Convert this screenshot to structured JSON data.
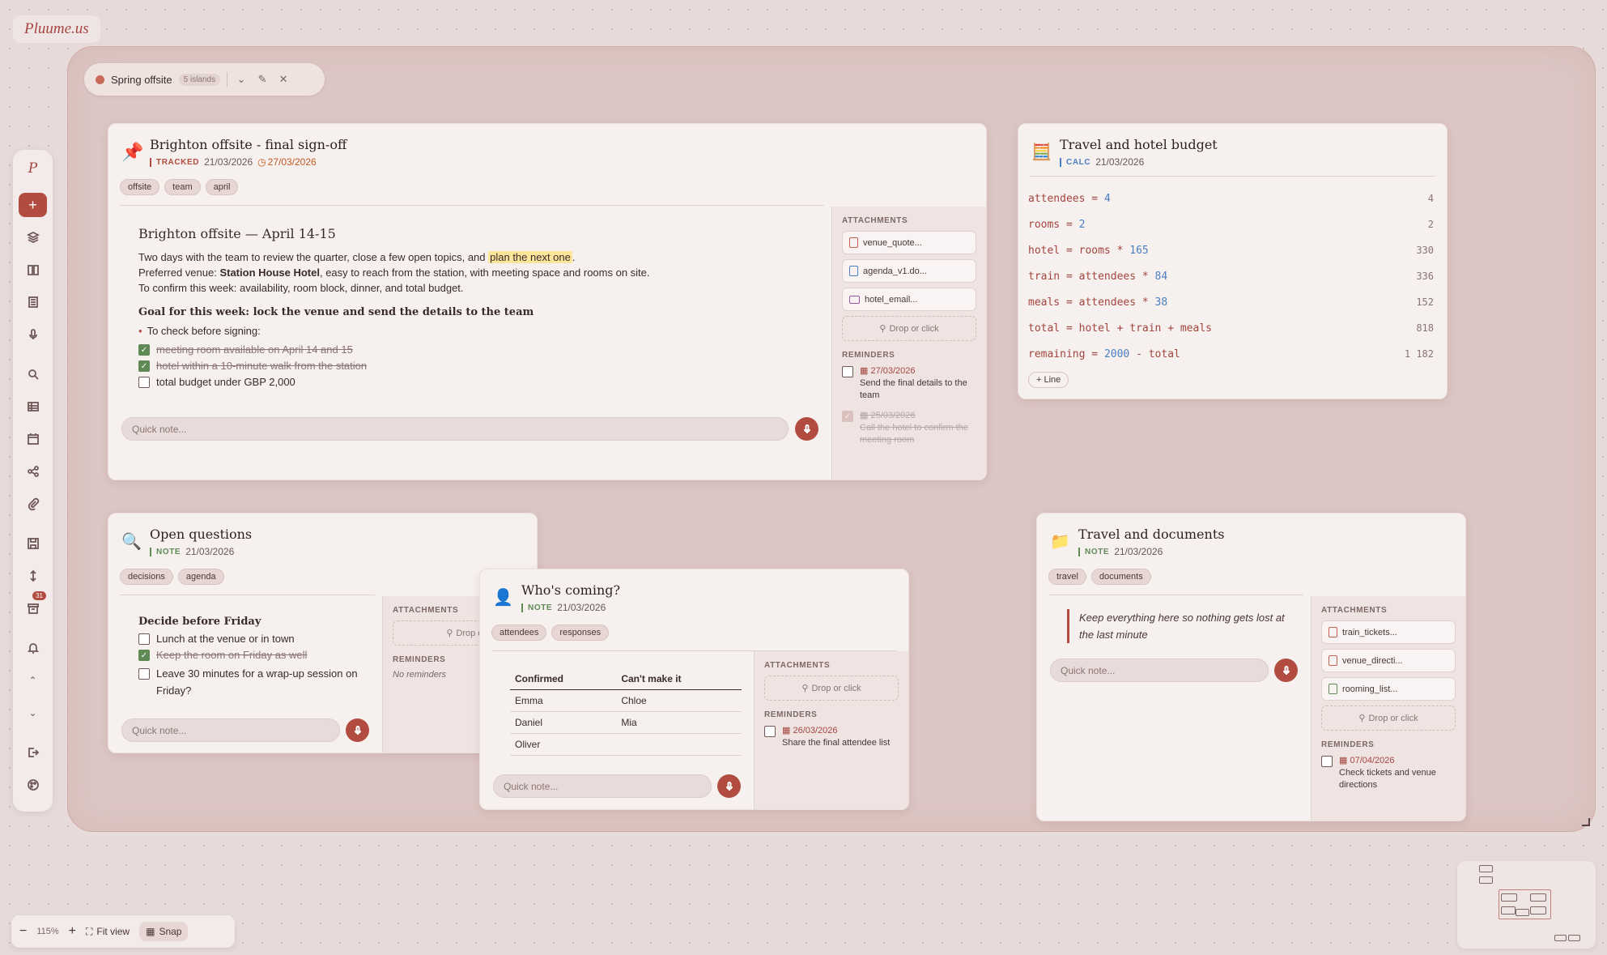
{
  "app": {
    "logo": "Pluume.us"
  },
  "group": {
    "name": "Spring offsite",
    "count": "5 islands"
  },
  "zoom": {
    "level": "115%",
    "fit_label": "Fit view",
    "snap_label": "Snap"
  },
  "sidebar": {
    "logo": "P",
    "badge": "31"
  },
  "card1": {
    "title": "Brighton offsite - final sign-off",
    "kind": "TRACKED",
    "date": "21/03/2026",
    "due": "27/03/2026",
    "tags": [
      "offsite",
      "team",
      "april"
    ],
    "heading": "Brighton offsite — April 14-15",
    "line1_a": "Two days with the team to review the quarter, close a few open topics, and ",
    "line1_hl": "plan the next one",
    "line1_b": ".",
    "line2_a": "Preferred venue: ",
    "line2_bold": "Station House Hotel",
    "line2_b": ", easy to reach from the station, with meeting space and rooms on site.",
    "line3": "To confirm this week: availability, room block, dinner, and total budget.",
    "goal": "Goal for this week: lock the venue and send the details to the team",
    "bullet": "To check before signing:",
    "checks": [
      "meeting room available on April 14 and 15",
      "hotel within a 10-minute walk from the station",
      "total budget under GBP 2,000"
    ],
    "quick_note": "Quick note...",
    "attachments_label": "ATTACHMENTS",
    "attachments": [
      "venue_quote...",
      "agenda_v1.do...",
      "hotel_email..."
    ],
    "drop": "Drop or click",
    "reminders_label": "REMINDERS",
    "reminders": [
      {
        "date": "27/03/2026",
        "text": "Send the final details to the team"
      },
      {
        "date": "25/03/2026",
        "text": "Call the hotel to confirm the meeting room"
      }
    ]
  },
  "card2": {
    "title": "Travel and hotel budget",
    "kind": "CALC",
    "date": "21/03/2026",
    "rows": [
      {
        "name": "attendees",
        "expr": "4",
        "result": "4"
      },
      {
        "name": "rooms",
        "expr": "2",
        "result": "2"
      },
      {
        "name": "hotel",
        "expr": "rooms * 165",
        "result": "330"
      },
      {
        "name": "train",
        "expr": "attendees * 84",
        "result": "336"
      },
      {
        "name": "meals",
        "expr": "attendees * 38",
        "result": "152"
      },
      {
        "name": "total",
        "expr": "hotel + train + meals",
        "result": "818"
      },
      {
        "name": "remaining",
        "expr": "2000 - total",
        "result": "1 182"
      }
    ],
    "add_line": "+ Line"
  },
  "card3": {
    "title": "Open questions",
    "kind": "NOTE",
    "date": "21/03/2026",
    "tags": [
      "decisions",
      "agenda"
    ],
    "heading": "Decide before Friday",
    "checks": [
      "Lunch at the venue or in town",
      "Keep the room on Friday as well",
      "Leave 30 minutes for a wrap-up session on Friday?"
    ],
    "quick_note": "Quick note...",
    "attachments_label": "ATTACHMENTS",
    "drop": "Drop or c",
    "reminders_label": "REMINDERS",
    "no_reminders": "No reminders"
  },
  "card4": {
    "title": "Who's coming?",
    "kind": "NOTE",
    "date": "21/03/2026",
    "tags": [
      "attendees",
      "responses"
    ],
    "headers": [
      "Confirmed",
      "Can't make it"
    ],
    "rows": [
      [
        "Emma",
        "Chloe"
      ],
      [
        "Daniel",
        "Mia"
      ],
      [
        "Oliver",
        ""
      ]
    ],
    "quick_note": "Quick note...",
    "attachments_label": "ATTACHMENTS",
    "drop": "Drop or click",
    "reminders_label": "REMINDERS",
    "reminder": {
      "date": "26/03/2026",
      "text": "Share the final attendee list"
    }
  },
  "card5": {
    "title": "Travel and documents",
    "kind": "NOTE",
    "date": "21/03/2026",
    "tags": [
      "travel",
      "documents"
    ],
    "quote": "Keep everything here so nothing gets lost at the last minute",
    "quick_note": "Quick note...",
    "attachments_label": "ATTACHMENTS",
    "attachments": [
      "train_tickets...",
      "venue_directi...",
      "rooming_list..."
    ],
    "drop": "Drop or click",
    "reminders_label": "REMINDERS",
    "reminder": {
      "date": "07/04/2026",
      "text": "Check tickets and venue directions"
    }
  },
  "colors": {
    "accent": "#b34c40",
    "tracked": "#b34c40",
    "calc": "#4a7fc1",
    "note": "#5f8a56"
  }
}
